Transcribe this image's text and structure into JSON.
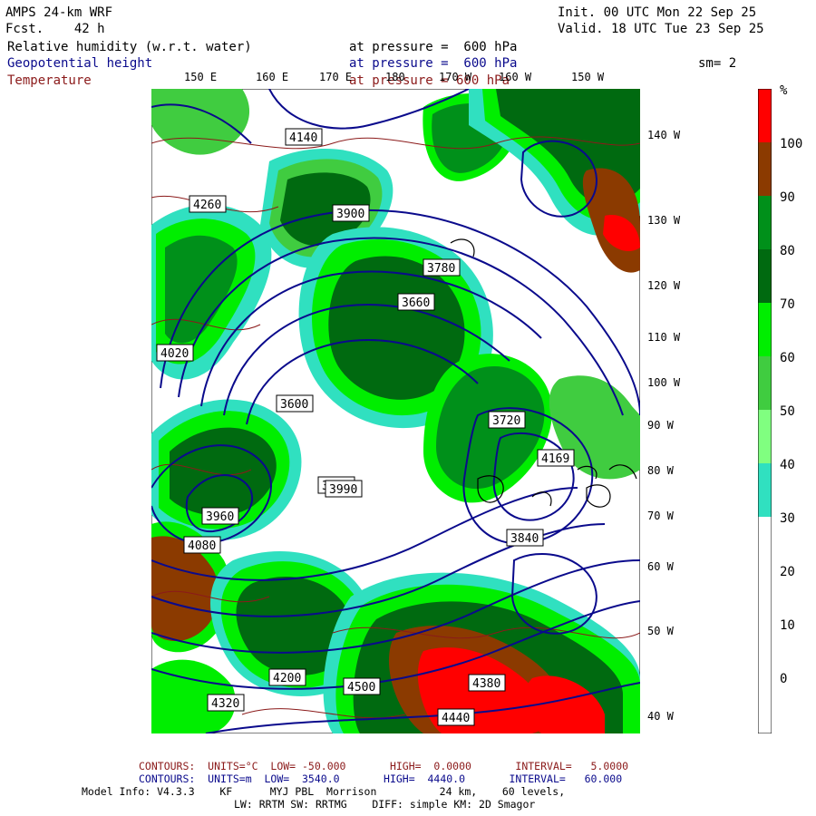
{
  "header": {
    "model": "AMPS 24-km WRF",
    "fcst": "Fcst.    42 h",
    "init": "Init. 00 UTC Mon 22 Sep 25",
    "valid": "Valid. 18 UTC Tue 23 Sep 25",
    "rh_label": "Relative humidity (w.r.t. water)",
    "rh_pressure": "at pressure =  600 hPa",
    "gh_label": "Geopotential height",
    "gh_pressure": "at pressure =  600 hPa",
    "t_label": "Temperature",
    "t_pressure": "at pressure = 600 hPa",
    "smoothing": "sm= 2"
  },
  "lon_top": [
    "150 E",
    "160 E",
    "170 E",
    "180",
    "170 W",
    "160 W",
    "150 W"
  ],
  "lon_right": [
    "140 W",
    "130 W",
    "120 W",
    "110 W",
    "100 W",
    "90 W",
    "80 W",
    "70 W",
    "60 W",
    "50 W",
    "40 W"
  ],
  "height_labels": [
    "4260",
    "4140",
    "4020",
    "3900",
    "3780",
    "3660",
    "3540",
    "3600",
    "3720",
    "3840",
    "3960",
    "4080",
    "4200",
    "4320",
    "4440",
    "4380",
    "4500",
    "3990",
    "4169"
  ],
  "colorbar": {
    "unit": "%",
    "labels": [
      "100",
      "90",
      "80",
      "70",
      "60",
      "50",
      "40",
      "30",
      "20",
      "10",
      "0"
    ],
    "colors": [
      "#ff0000",
      "#8b3a00",
      "#00901a",
      "#006a10",
      "#00ee00",
      "#40cc40",
      "#80ff80",
      "#30e0c0",
      "#ffffff",
      "#ffffff",
      "#ffffff"
    ]
  },
  "footer": {
    "t_contours": "CONTOURS:  UNITS=°C  LOW= -50.000       HIGH=  0.0000       INTERVAL=   5.0000",
    "gh_contours": "CONTOURS:  UNITS=m  LOW=  3540.0       HIGH=  4440.0       INTERVAL=   60.000",
    "model_info": "Model Info: V4.3.3    KF      MYJ PBL  Morrison          24 km,    60 levels,",
    "physics": "LW: RRTM SW: RRTMG    DIFF: simple KM: 2D Smagor"
  },
  "colors": {
    "height_contour": "#0a0a8c",
    "temp_contour": "#8b1a1a",
    "coast": "#000000"
  }
}
